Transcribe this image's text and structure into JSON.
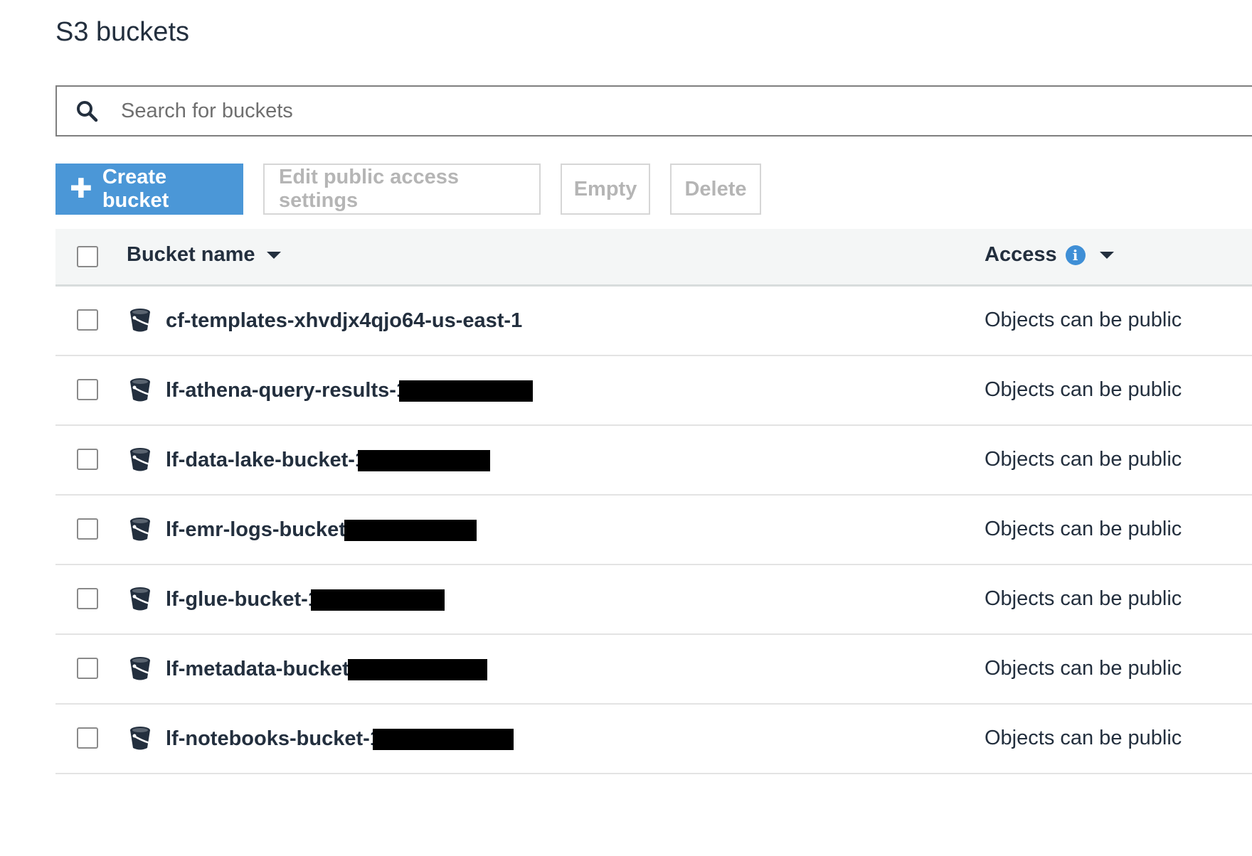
{
  "page": {
    "title": "S3 buckets"
  },
  "search": {
    "placeholder": "Search for buckets",
    "value": ""
  },
  "toolbar": {
    "create_label": "Create bucket",
    "edit_label": "Edit public access settings",
    "empty_label": "Empty",
    "delete_label": "Delete"
  },
  "table": {
    "columns": {
      "name": "Bucket name",
      "access": "Access"
    },
    "rows": [
      {
        "name": "cf-templates-xhvdjx4qjo64-us-east-1",
        "redacted": false,
        "access": "Objects can be public"
      },
      {
        "name": "lf-athena-query-results-1",
        "redacted": true,
        "access": "Objects can be public"
      },
      {
        "name": "lf-data-lake-bucket-1",
        "redacted": true,
        "access": "Objects can be public"
      },
      {
        "name": "lf-emr-logs-bucket-",
        "redacted": true,
        "access": "Objects can be public"
      },
      {
        "name": "lf-glue-bucket-1",
        "redacted": true,
        "access": "Objects can be public"
      },
      {
        "name": "lf-metadata-bucket-",
        "redacted": true,
        "access": "Objects can be public"
      },
      {
        "name": "lf-notebooks-bucket-1",
        "redacted": true,
        "access": "Objects can be public"
      }
    ]
  },
  "colors": {
    "primary_button": "#4b97d7",
    "info_icon": "#3f8fd6",
    "text": "#232f3e",
    "disabled_text": "#b5b5b5"
  },
  "icons": {
    "search": "search-icon",
    "plus": "plus-icon",
    "info": "info-icon",
    "bucket": "bucket-icon",
    "sort": "caret-down-icon"
  }
}
